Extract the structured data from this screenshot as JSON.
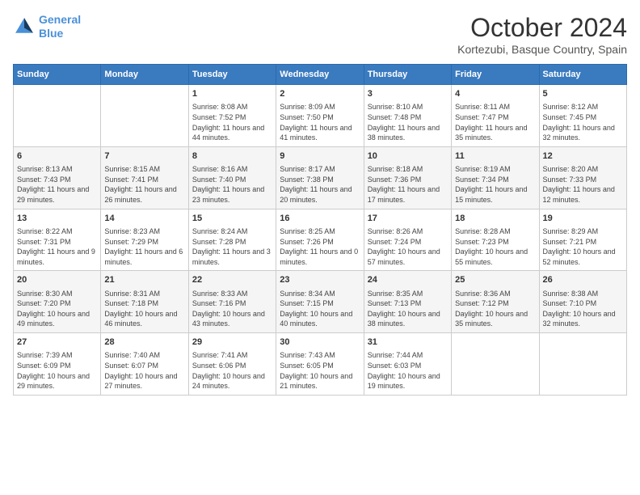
{
  "header": {
    "logo_line1": "General",
    "logo_line2": "Blue",
    "month": "October 2024",
    "location": "Kortezubi, Basque Country, Spain"
  },
  "days_of_week": [
    "Sunday",
    "Monday",
    "Tuesday",
    "Wednesday",
    "Thursday",
    "Friday",
    "Saturday"
  ],
  "weeks": [
    [
      {
        "day": "",
        "info": ""
      },
      {
        "day": "",
        "info": ""
      },
      {
        "day": "1",
        "info": "Sunrise: 8:08 AM\nSunset: 7:52 PM\nDaylight: 11 hours and 44 minutes."
      },
      {
        "day": "2",
        "info": "Sunrise: 8:09 AM\nSunset: 7:50 PM\nDaylight: 11 hours and 41 minutes."
      },
      {
        "day": "3",
        "info": "Sunrise: 8:10 AM\nSunset: 7:48 PM\nDaylight: 11 hours and 38 minutes."
      },
      {
        "day": "4",
        "info": "Sunrise: 8:11 AM\nSunset: 7:47 PM\nDaylight: 11 hours and 35 minutes."
      },
      {
        "day": "5",
        "info": "Sunrise: 8:12 AM\nSunset: 7:45 PM\nDaylight: 11 hours and 32 minutes."
      }
    ],
    [
      {
        "day": "6",
        "info": "Sunrise: 8:13 AM\nSunset: 7:43 PM\nDaylight: 11 hours and 29 minutes."
      },
      {
        "day": "7",
        "info": "Sunrise: 8:15 AM\nSunset: 7:41 PM\nDaylight: 11 hours and 26 minutes."
      },
      {
        "day": "8",
        "info": "Sunrise: 8:16 AM\nSunset: 7:40 PM\nDaylight: 11 hours and 23 minutes."
      },
      {
        "day": "9",
        "info": "Sunrise: 8:17 AM\nSunset: 7:38 PM\nDaylight: 11 hours and 20 minutes."
      },
      {
        "day": "10",
        "info": "Sunrise: 8:18 AM\nSunset: 7:36 PM\nDaylight: 11 hours and 17 minutes."
      },
      {
        "day": "11",
        "info": "Sunrise: 8:19 AM\nSunset: 7:34 PM\nDaylight: 11 hours and 15 minutes."
      },
      {
        "day": "12",
        "info": "Sunrise: 8:20 AM\nSunset: 7:33 PM\nDaylight: 11 hours and 12 minutes."
      }
    ],
    [
      {
        "day": "13",
        "info": "Sunrise: 8:22 AM\nSunset: 7:31 PM\nDaylight: 11 hours and 9 minutes."
      },
      {
        "day": "14",
        "info": "Sunrise: 8:23 AM\nSunset: 7:29 PM\nDaylight: 11 hours and 6 minutes."
      },
      {
        "day": "15",
        "info": "Sunrise: 8:24 AM\nSunset: 7:28 PM\nDaylight: 11 hours and 3 minutes."
      },
      {
        "day": "16",
        "info": "Sunrise: 8:25 AM\nSunset: 7:26 PM\nDaylight: 11 hours and 0 minutes."
      },
      {
        "day": "17",
        "info": "Sunrise: 8:26 AM\nSunset: 7:24 PM\nDaylight: 10 hours and 57 minutes."
      },
      {
        "day": "18",
        "info": "Sunrise: 8:28 AM\nSunset: 7:23 PM\nDaylight: 10 hours and 55 minutes."
      },
      {
        "day": "19",
        "info": "Sunrise: 8:29 AM\nSunset: 7:21 PM\nDaylight: 10 hours and 52 minutes."
      }
    ],
    [
      {
        "day": "20",
        "info": "Sunrise: 8:30 AM\nSunset: 7:20 PM\nDaylight: 10 hours and 49 minutes."
      },
      {
        "day": "21",
        "info": "Sunrise: 8:31 AM\nSunset: 7:18 PM\nDaylight: 10 hours and 46 minutes."
      },
      {
        "day": "22",
        "info": "Sunrise: 8:33 AM\nSunset: 7:16 PM\nDaylight: 10 hours and 43 minutes."
      },
      {
        "day": "23",
        "info": "Sunrise: 8:34 AM\nSunset: 7:15 PM\nDaylight: 10 hours and 40 minutes."
      },
      {
        "day": "24",
        "info": "Sunrise: 8:35 AM\nSunset: 7:13 PM\nDaylight: 10 hours and 38 minutes."
      },
      {
        "day": "25",
        "info": "Sunrise: 8:36 AM\nSunset: 7:12 PM\nDaylight: 10 hours and 35 minutes."
      },
      {
        "day": "26",
        "info": "Sunrise: 8:38 AM\nSunset: 7:10 PM\nDaylight: 10 hours and 32 minutes."
      }
    ],
    [
      {
        "day": "27",
        "info": "Sunrise: 7:39 AM\nSunset: 6:09 PM\nDaylight: 10 hours and 29 minutes."
      },
      {
        "day": "28",
        "info": "Sunrise: 7:40 AM\nSunset: 6:07 PM\nDaylight: 10 hours and 27 minutes."
      },
      {
        "day": "29",
        "info": "Sunrise: 7:41 AM\nSunset: 6:06 PM\nDaylight: 10 hours and 24 minutes."
      },
      {
        "day": "30",
        "info": "Sunrise: 7:43 AM\nSunset: 6:05 PM\nDaylight: 10 hours and 21 minutes."
      },
      {
        "day": "31",
        "info": "Sunrise: 7:44 AM\nSunset: 6:03 PM\nDaylight: 10 hours and 19 minutes."
      },
      {
        "day": "",
        "info": ""
      },
      {
        "day": "",
        "info": ""
      }
    ]
  ]
}
